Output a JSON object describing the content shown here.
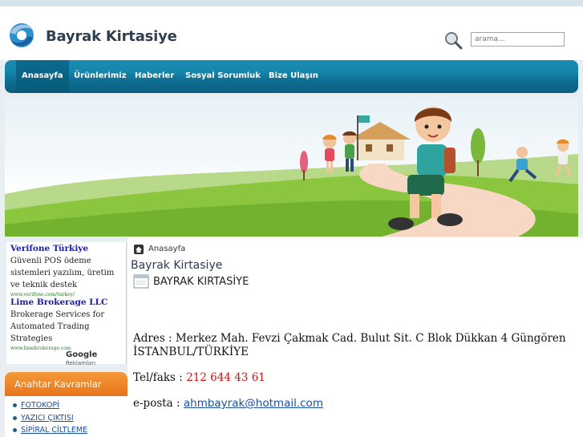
{
  "header": {
    "site_name": "Bayrak Kirtasiye",
    "search_placeholder": "arama..."
  },
  "nav": {
    "items": [
      {
        "label": "Anasayfa",
        "active": true
      },
      {
        "label": "Ürünlerimiz"
      },
      {
        "label": "Haberler"
      },
      {
        "label": "Sosyal Sorumluk"
      },
      {
        "label": "Bize Ulaşın"
      }
    ]
  },
  "ads": {
    "items": [
      {
        "title": "Verifone Türkiye",
        "text": "Güvenli POS ödeme sistemleri yazılım, üretim ve teknik destek",
        "url": "www.verifone.com/turkey/"
      },
      {
        "title": "Lime Brokerage LLC",
        "text": "Brokerage Services for Automated Trading Strategies",
        "url": "www.limebrokerage.com"
      }
    ],
    "google_label": "Google",
    "google_suffix": "Reklamları"
  },
  "keywords": {
    "title": "Anahtar Kavramlar",
    "items": [
      "FOTOKOPİ",
      "YAZICI ÇIKTISI",
      "SİPİRAL CİLTLEME"
    ]
  },
  "content": {
    "breadcrumb": "Anasayfa",
    "title": "Bayrak Kirtasiye",
    "subtitle": "BAYRAK KIRTASİYE",
    "address_line1": "Adres : Merkez Mah. Fevzi Çakmak Cad. Bulut Sit. C Blok Dükkan 4 Güngören",
    "address_line2": "İSTANBUL/TÜRKİYE",
    "tel_label": "Tel/faks : ",
    "tel_number": "212 644 43 61",
    "email_label": "e-posta : ",
    "email": "ahmbayrak@hotmail.com"
  },
  "colors": {
    "nav": "#1487ad",
    "keyword_header": "#e8741a",
    "phone": "#d01010",
    "link": "#1a4fa0"
  }
}
